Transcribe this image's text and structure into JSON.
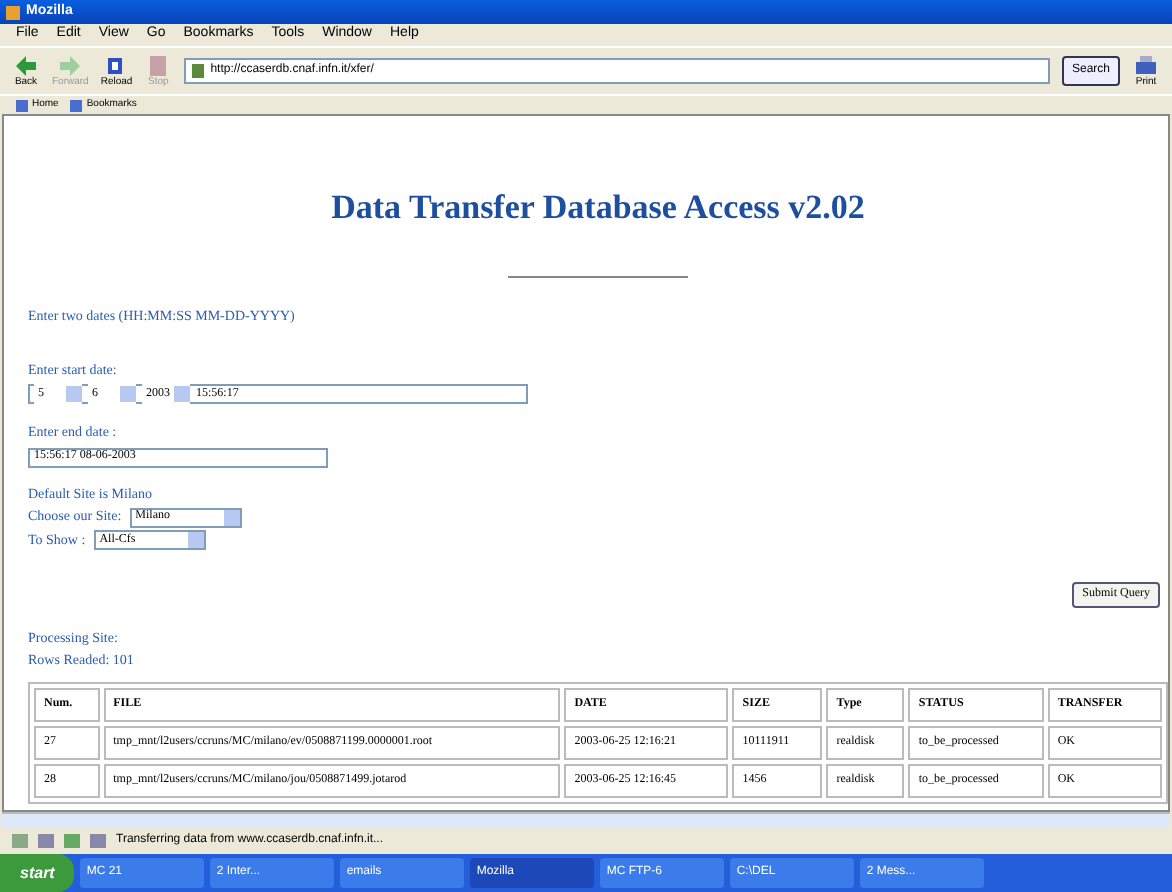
{
  "window": {
    "title": "Mozilla"
  },
  "menu": [
    "File",
    "Edit",
    "View",
    "Go",
    "Bookmarks",
    "Tools",
    "Window",
    "Help"
  ],
  "toolbar": [
    {
      "kind": "back",
      "label": "Back",
      "disabled": false
    },
    {
      "kind": "forward",
      "label": "Forward",
      "disabled": true
    },
    {
      "kind": "reload",
      "label": "Reload",
      "disabled": false
    },
    {
      "kind": "stop",
      "label": "Stop",
      "disabled": true
    }
  ],
  "address": {
    "value": "http://ccaserdb.cnaf.infn.it/xfer/"
  },
  "search_button": "Search",
  "print_button": "Print",
  "bookmarks_bar": [
    "Home",
    "Bookmarks"
  ],
  "page": {
    "heading": "Data Transfer Database Access v2.02",
    "instructions": "Enter two dates (HH:MM:SS MM-DD-YYYY)",
    "start_label": "Enter start date:",
    "start_selects": [
      "5",
      "6",
      "2003"
    ],
    "start_time": "15:56:17",
    "end_label": "Enter end date :",
    "end_value": "15:56:17 08-06-2003",
    "default_site": "Default Site is Milano",
    "site_label": "Choose our Site:",
    "site_value": "Milano",
    "show_label": "To Show :",
    "show_value": "All-Cfs",
    "submit": "Submit Query",
    "processing": "Processing Site:",
    "rows_read": "Rows Readed: 101",
    "table": {
      "columns": [
        "Num.",
        "FILE",
        "DATE",
        "SIZE",
        "Type",
        "STATUS",
        "TRANSFER"
      ],
      "rows": [
        [
          "27",
          "tmp_mnt/l2users/ccruns/MC/milano/ev/0508871199.0000001.root",
          "2003-06-25 12:16:21",
          "10111911",
          "realdisk",
          "to_be_processed",
          "OK"
        ],
        [
          "28",
          "tmp_mnt/l2users/ccruns/MC/milano/jou/0508871499.jotarod",
          "2003-06-25 12:16:45",
          "1456",
          "realdisk",
          "to_be_processed",
          "OK"
        ]
      ]
    }
  },
  "status_bar": "Transferring data from www.ccaserdb.cnaf.infn.it...",
  "taskbar": {
    "start": "start",
    "items": [
      {
        "label": "MC 21",
        "selected": false
      },
      {
        "label": "2 Inter...",
        "selected": false
      },
      {
        "label": "emails",
        "selected": false
      },
      {
        "label": "Mozilla",
        "selected": true
      },
      {
        "label": "MC FTP-6",
        "selected": false
      },
      {
        "label": "C:\\DEL",
        "selected": false
      },
      {
        "label": "2 Mess...",
        "selected": false
      }
    ]
  }
}
